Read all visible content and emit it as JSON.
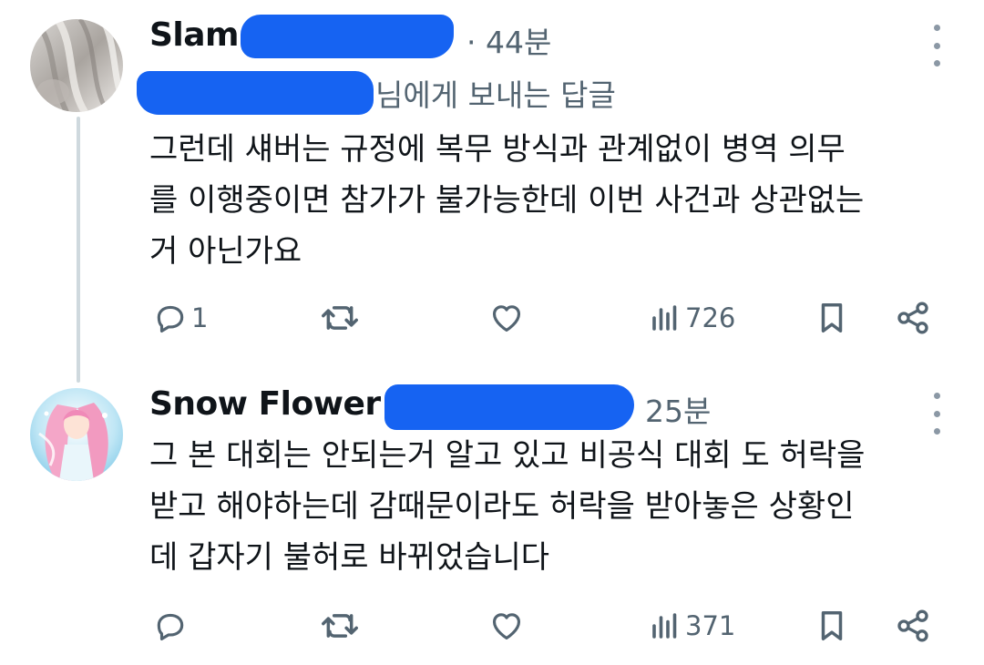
{
  "posts": [
    {
      "author": "Slam",
      "time": "· 44분",
      "reply_to_suffix": "님에게 보내는 답글",
      "body_lines": [
        "그런데 섀버는 규정에 복무 방식과 관계없이 병역 의무",
        "를 이행중이면 참가가 불가능한데 이번 사건과 상관없는",
        "거 아닌가요"
      ],
      "actions": {
        "replies": "1",
        "views": "726"
      }
    },
    {
      "author": "Snow Flower",
      "time": "25분",
      "body_lines": [
        "그 본 대회는 안되는거 알고 있고 비공식 대회 도 허락을",
        "받고 해야하는데 감때문이라도 허락을 받아놓은 상황인",
        "데 갑자기 불허로 바뀌었습니다"
      ],
      "actions": {
        "views": "371"
      }
    }
  ],
  "icons": {
    "reply": "reply-icon",
    "repost": "repost-icon",
    "like": "heart-icon",
    "views": "views-chart-icon",
    "bookmark": "bookmark-icon",
    "share": "share-icon",
    "more": "more-vertical-icon"
  },
  "colors": {
    "text": "#0f1419",
    "muted": "#536471",
    "redaction": "#1663f2",
    "thread_line": "#cfd9de"
  }
}
